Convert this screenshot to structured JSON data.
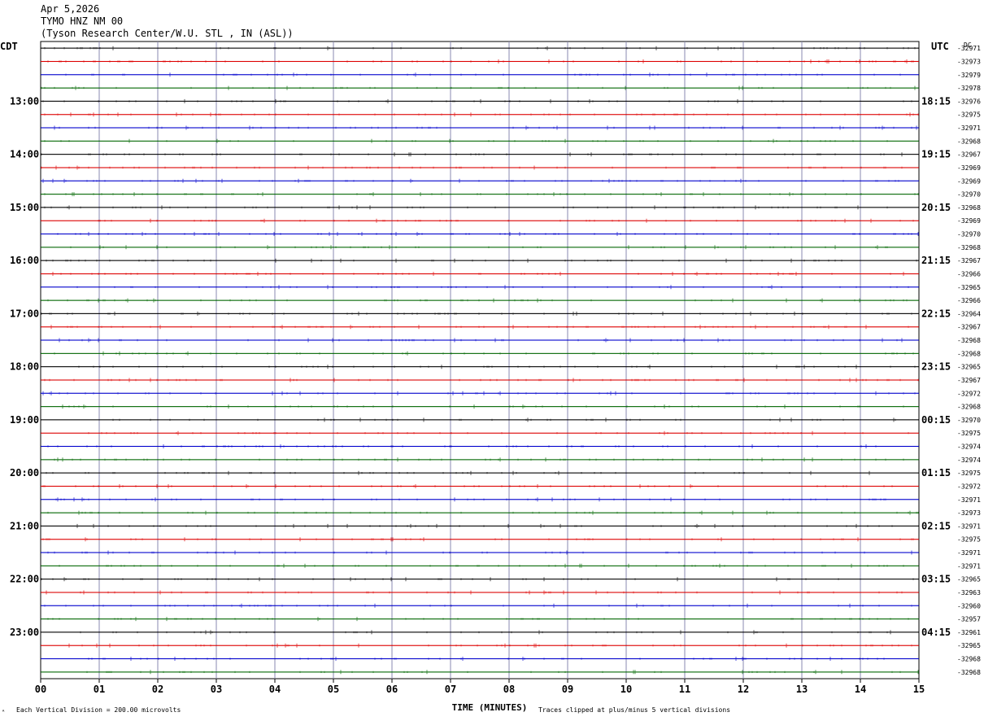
{
  "header": {
    "date": "Apr 5,2026",
    "station": "TYMO HNZ NM 00",
    "site": "(Tyson Research Center/W.U. STL , IN (ASL))"
  },
  "chart_data": {
    "type": "line",
    "title": "",
    "left_axis_label": "CDT",
    "right_axis_label": "UTC",
    "dc_label": "DC",
    "xlabel": "TIME (MINUTES)",
    "xlim": [
      0,
      15
    ],
    "x_ticks": [
      "00",
      "01",
      "02",
      "03",
      "04",
      "05",
      "06",
      "07",
      "08",
      "09",
      "10",
      "11",
      "12",
      "13",
      "14",
      "15"
    ],
    "grid": true,
    "trace_colors": [
      "#000000",
      "#dd0000",
      "#0000cc",
      "#006600"
    ],
    "rows_count": 48,
    "left_time_labels": [
      {
        "row": 4,
        "text": "13:00"
      },
      {
        "row": 8,
        "text": "14:00"
      },
      {
        "row": 12,
        "text": "15:00"
      },
      {
        "row": 16,
        "text": "16:00"
      },
      {
        "row": 20,
        "text": "17:00"
      },
      {
        "row": 24,
        "text": "18:00"
      },
      {
        "row": 28,
        "text": "19:00"
      },
      {
        "row": 32,
        "text": "20:00"
      },
      {
        "row": 36,
        "text": "21:00"
      },
      {
        "row": 40,
        "text": "22:00"
      },
      {
        "row": 44,
        "text": "23:00"
      }
    ],
    "right_time_labels": [
      {
        "row": 4,
        "text": "18:15"
      },
      {
        "row": 8,
        "text": "19:15"
      },
      {
        "row": 12,
        "text": "20:15"
      },
      {
        "row": 16,
        "text": "21:15"
      },
      {
        "row": 20,
        "text": "22:15"
      },
      {
        "row": 24,
        "text": "23:15"
      },
      {
        "row": 28,
        "text": "00:15"
      },
      {
        "row": 32,
        "text": "01:15"
      },
      {
        "row": 36,
        "text": "02:15"
      },
      {
        "row": 40,
        "text": "03:15"
      },
      {
        "row": 44,
        "text": "04:15"
      }
    ],
    "dc_offsets": [
      "-32971",
      "-32973",
      "-32979",
      "-32978",
      "-32976",
      "-32975",
      "-32971",
      "-32968",
      "-32967",
      "-32969",
      "-32969",
      "-32970",
      "-32968",
      "-32969",
      "-32970",
      "-32968",
      "-32967",
      "-32966",
      "-32965",
      "-32966",
      "-32964",
      "-32967",
      "-32968",
      "-32968",
      "-32965",
      "-32967",
      "-32972",
      "-32968",
      "-32970",
      "-32975",
      "-32974",
      "-32974",
      "-32975",
      "-32972",
      "-32971",
      "-32973",
      "-32971",
      "-32975",
      "-32971",
      "-32971",
      "-32965",
      "-32963",
      "-32960",
      "-32957",
      "-32961",
      "-32965",
      "-32968",
      "-32968"
    ]
  },
  "footer": {
    "scale_note": "Each Vertical Division =  200.00 microvolts",
    "clip_note": "Traces clipped at plus/minus 5 vertical divisions",
    "logo_glyph": "ᴬ"
  }
}
